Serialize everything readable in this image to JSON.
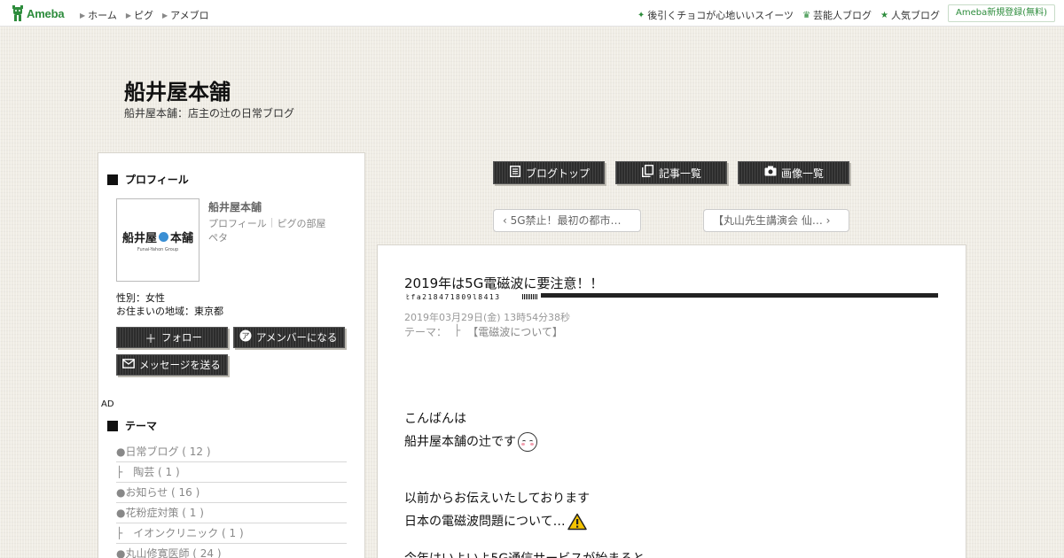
{
  "topbar": {
    "logo": "Ameba",
    "nav": [
      "ホーム",
      "ピグ",
      "アメブロ"
    ],
    "right_links": [
      {
        "icon": "sparkle-icon",
        "label": "後引くチョコが心地いいスイーツ"
      },
      {
        "icon": "crown-icon",
        "label": "芸能人ブログ"
      },
      {
        "icon": "star-icon",
        "label": "人気ブログ"
      }
    ],
    "register": "Ameba新規登録(無料)"
  },
  "blog": {
    "title": "船井屋本舗",
    "subtitle": "船井屋本舗：店主の辻の日常ブログ"
  },
  "profile": {
    "heading": "プロフィール",
    "logo_main_left": "船井屋",
    "logo_main_right": "本舗",
    "logo_sub": "Funai-Yahon Group",
    "name": "船井屋本舗",
    "link_profile": "プロフィール",
    "link_pig": "ピグの部屋",
    "peta": "ペタ",
    "gender": "性別：女性",
    "area": "お住まいの地域：東京都",
    "follow": "フォロー",
    "member": "アメンバーになる",
    "message": "メッセージを送る"
  },
  "ad_label": "AD",
  "themes": {
    "heading": "テーマ",
    "items": [
      "●日常ブログ ( 12 )",
      "├　陶芸 ( 1 )",
      "●お知らせ ( 16 )",
      "●花粉症対策 ( 1 )",
      "├　イオンクリニック ( 1 )",
      "●丸山修寛医師 ( 24 )"
    ]
  },
  "main_nav": {
    "top": "ブログトップ",
    "list": "記事一覧",
    "images": "画像一覧"
  },
  "pager": {
    "prev": "5G禁止！最初の都市…",
    "next": "【丸山先生講演会 仙…"
  },
  "article": {
    "title": "2019年は5G電磁波に要注意！！",
    "stamp": "ﾋfa218471809l8413",
    "date": "2019年03月29日(金) 13時54分38秒",
    "theme_label": "テーマ：",
    "theme_sep": "├",
    "theme_link": "【電磁波について】",
    "body": [
      "こんばんは",
      "船井屋本舗の辻です",
      "以前からお伝えいたしております",
      "日本の電磁波問題について…",
      "今年はいよいよ5G通信サービスが始まると"
    ]
  }
}
